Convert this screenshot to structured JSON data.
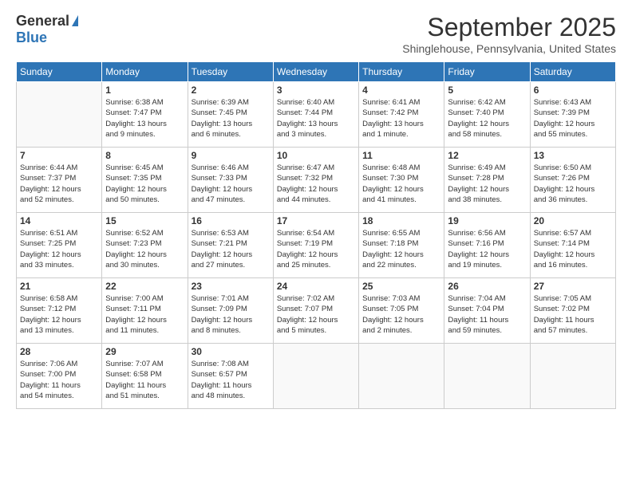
{
  "logo": {
    "general": "General",
    "blue": "Blue"
  },
  "header": {
    "month": "September 2025",
    "location": "Shinglehouse, Pennsylvania, United States"
  },
  "weekdays": [
    "Sunday",
    "Monday",
    "Tuesday",
    "Wednesday",
    "Thursday",
    "Friday",
    "Saturday"
  ],
  "weeks": [
    [
      {
        "day": "",
        "info": ""
      },
      {
        "day": "1",
        "info": "Sunrise: 6:38 AM\nSunset: 7:47 PM\nDaylight: 13 hours\nand 9 minutes."
      },
      {
        "day": "2",
        "info": "Sunrise: 6:39 AM\nSunset: 7:45 PM\nDaylight: 13 hours\nand 6 minutes."
      },
      {
        "day": "3",
        "info": "Sunrise: 6:40 AM\nSunset: 7:44 PM\nDaylight: 13 hours\nand 3 minutes."
      },
      {
        "day": "4",
        "info": "Sunrise: 6:41 AM\nSunset: 7:42 PM\nDaylight: 13 hours\nand 1 minute."
      },
      {
        "day": "5",
        "info": "Sunrise: 6:42 AM\nSunset: 7:40 PM\nDaylight: 12 hours\nand 58 minutes."
      },
      {
        "day": "6",
        "info": "Sunrise: 6:43 AM\nSunset: 7:39 PM\nDaylight: 12 hours\nand 55 minutes."
      }
    ],
    [
      {
        "day": "7",
        "info": "Sunrise: 6:44 AM\nSunset: 7:37 PM\nDaylight: 12 hours\nand 52 minutes."
      },
      {
        "day": "8",
        "info": "Sunrise: 6:45 AM\nSunset: 7:35 PM\nDaylight: 12 hours\nand 50 minutes."
      },
      {
        "day": "9",
        "info": "Sunrise: 6:46 AM\nSunset: 7:33 PM\nDaylight: 12 hours\nand 47 minutes."
      },
      {
        "day": "10",
        "info": "Sunrise: 6:47 AM\nSunset: 7:32 PM\nDaylight: 12 hours\nand 44 minutes."
      },
      {
        "day": "11",
        "info": "Sunrise: 6:48 AM\nSunset: 7:30 PM\nDaylight: 12 hours\nand 41 minutes."
      },
      {
        "day": "12",
        "info": "Sunrise: 6:49 AM\nSunset: 7:28 PM\nDaylight: 12 hours\nand 38 minutes."
      },
      {
        "day": "13",
        "info": "Sunrise: 6:50 AM\nSunset: 7:26 PM\nDaylight: 12 hours\nand 36 minutes."
      }
    ],
    [
      {
        "day": "14",
        "info": "Sunrise: 6:51 AM\nSunset: 7:25 PM\nDaylight: 12 hours\nand 33 minutes."
      },
      {
        "day": "15",
        "info": "Sunrise: 6:52 AM\nSunset: 7:23 PM\nDaylight: 12 hours\nand 30 minutes."
      },
      {
        "day": "16",
        "info": "Sunrise: 6:53 AM\nSunset: 7:21 PM\nDaylight: 12 hours\nand 27 minutes."
      },
      {
        "day": "17",
        "info": "Sunrise: 6:54 AM\nSunset: 7:19 PM\nDaylight: 12 hours\nand 25 minutes."
      },
      {
        "day": "18",
        "info": "Sunrise: 6:55 AM\nSunset: 7:18 PM\nDaylight: 12 hours\nand 22 minutes."
      },
      {
        "day": "19",
        "info": "Sunrise: 6:56 AM\nSunset: 7:16 PM\nDaylight: 12 hours\nand 19 minutes."
      },
      {
        "day": "20",
        "info": "Sunrise: 6:57 AM\nSunset: 7:14 PM\nDaylight: 12 hours\nand 16 minutes."
      }
    ],
    [
      {
        "day": "21",
        "info": "Sunrise: 6:58 AM\nSunset: 7:12 PM\nDaylight: 12 hours\nand 13 minutes."
      },
      {
        "day": "22",
        "info": "Sunrise: 7:00 AM\nSunset: 7:11 PM\nDaylight: 12 hours\nand 11 minutes."
      },
      {
        "day": "23",
        "info": "Sunrise: 7:01 AM\nSunset: 7:09 PM\nDaylight: 12 hours\nand 8 minutes."
      },
      {
        "day": "24",
        "info": "Sunrise: 7:02 AM\nSunset: 7:07 PM\nDaylight: 12 hours\nand 5 minutes."
      },
      {
        "day": "25",
        "info": "Sunrise: 7:03 AM\nSunset: 7:05 PM\nDaylight: 12 hours\nand 2 minutes."
      },
      {
        "day": "26",
        "info": "Sunrise: 7:04 AM\nSunset: 7:04 PM\nDaylight: 11 hours\nand 59 minutes."
      },
      {
        "day": "27",
        "info": "Sunrise: 7:05 AM\nSunset: 7:02 PM\nDaylight: 11 hours\nand 57 minutes."
      }
    ],
    [
      {
        "day": "28",
        "info": "Sunrise: 7:06 AM\nSunset: 7:00 PM\nDaylight: 11 hours\nand 54 minutes."
      },
      {
        "day": "29",
        "info": "Sunrise: 7:07 AM\nSunset: 6:58 PM\nDaylight: 11 hours\nand 51 minutes."
      },
      {
        "day": "30",
        "info": "Sunrise: 7:08 AM\nSunset: 6:57 PM\nDaylight: 11 hours\nand 48 minutes."
      },
      {
        "day": "",
        "info": ""
      },
      {
        "day": "",
        "info": ""
      },
      {
        "day": "",
        "info": ""
      },
      {
        "day": "",
        "info": ""
      }
    ]
  ]
}
